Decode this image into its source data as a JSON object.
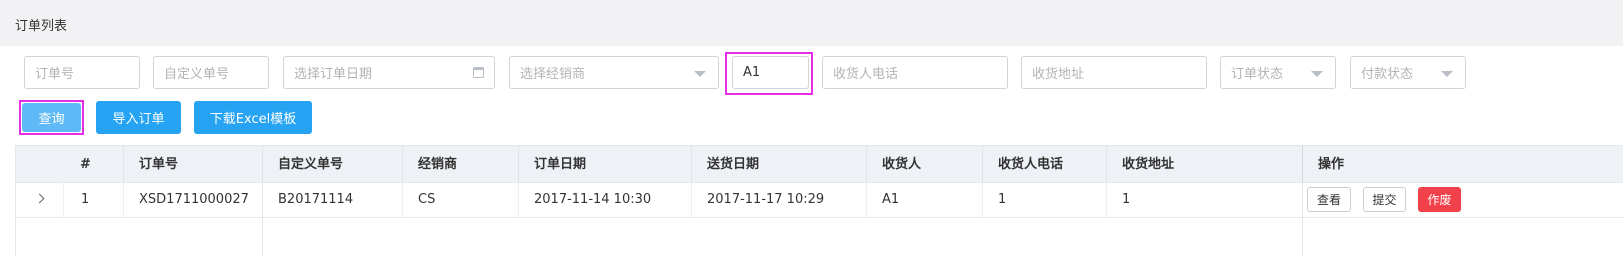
{
  "page": {
    "title": "订单列表"
  },
  "filters": {
    "order_no": {
      "placeholder": "订单号",
      "value": ""
    },
    "custom_no": {
      "placeholder": "自定义单号",
      "value": ""
    },
    "order_date": {
      "placeholder": "选择订单日期",
      "value": "",
      "icon": "calendar-icon"
    },
    "dealer": {
      "placeholder": "选择经销商",
      "value": ""
    },
    "receiver": {
      "placeholder": "",
      "value": "A1"
    },
    "receiver_phone": {
      "placeholder": "收货人电话",
      "value": ""
    },
    "receiver_address": {
      "placeholder": "收货地址",
      "value": ""
    },
    "order_status": {
      "placeholder": "订单状态",
      "value": ""
    },
    "payment_status": {
      "placeholder": "付款状态",
      "value": ""
    }
  },
  "actions": {
    "query": "查询",
    "import_orders": "导入订单",
    "download_template": "下载Excel模板"
  },
  "table": {
    "columns": [
      "#",
      "订单号",
      "自定义单号",
      "经销商",
      "订单日期",
      "送货日期",
      "收货人",
      "收货人电话",
      "收货地址",
      "操作"
    ],
    "rows": [
      {
        "index": "1",
        "order_no": "XSD1711000027",
        "custom_no": "B20171114",
        "dealer": "CS",
        "order_date": "2017-11-14 10:30",
        "delivery_date": "2017-11-17 10:29",
        "receiver": "A1",
        "receiver_phone": "1",
        "receiver_address": "1",
        "ops": {
          "view": "查看",
          "submit": "提交",
          "void": "作废"
        }
      }
    ]
  },
  "colors": {
    "primary": "#27a3f3",
    "query_button": "#5fb9f6",
    "danger": "#f2414a",
    "highlight": "#e32ee5",
    "header_bg": "#eef1f5",
    "title_bg": "#f2f2f4"
  }
}
